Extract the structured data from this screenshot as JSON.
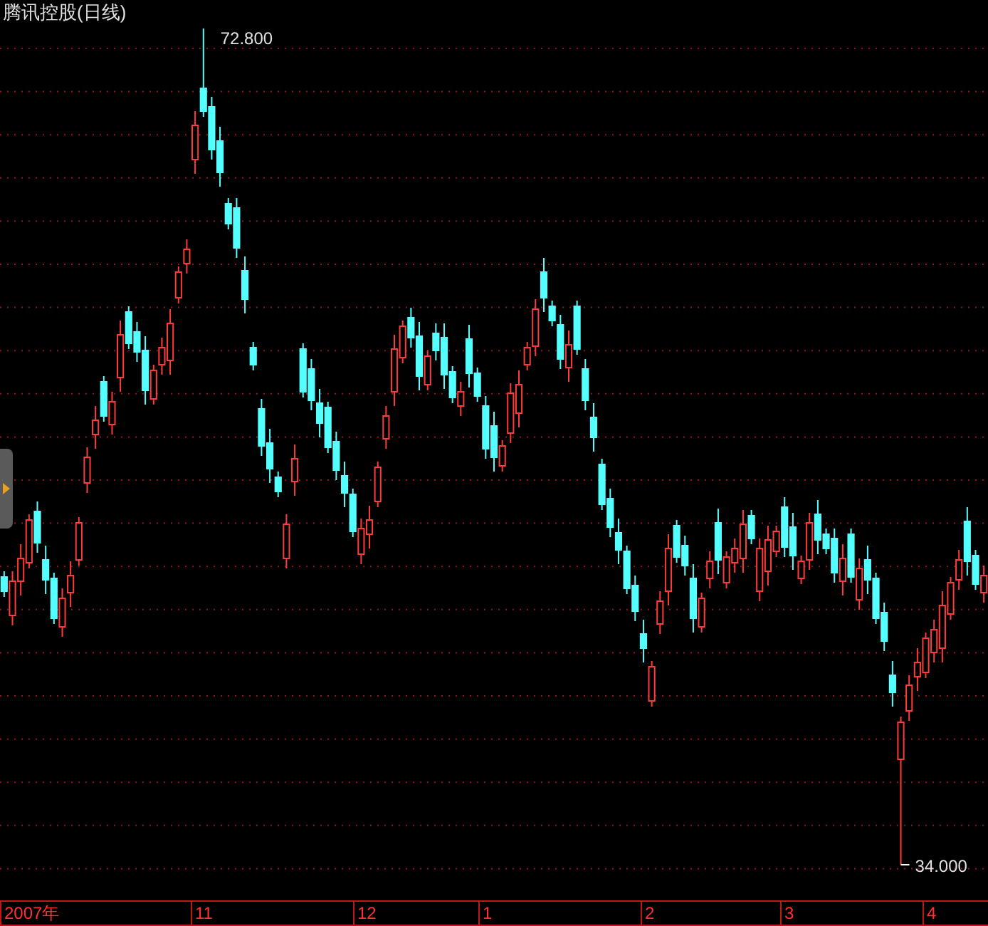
{
  "title": "腾讯控股(日线)",
  "high_label": "72.800",
  "low_label": "34.000",
  "time_axis": [
    "2007年",
    "11",
    "12",
    "1",
    "2",
    "3",
    "4"
  ]
}
